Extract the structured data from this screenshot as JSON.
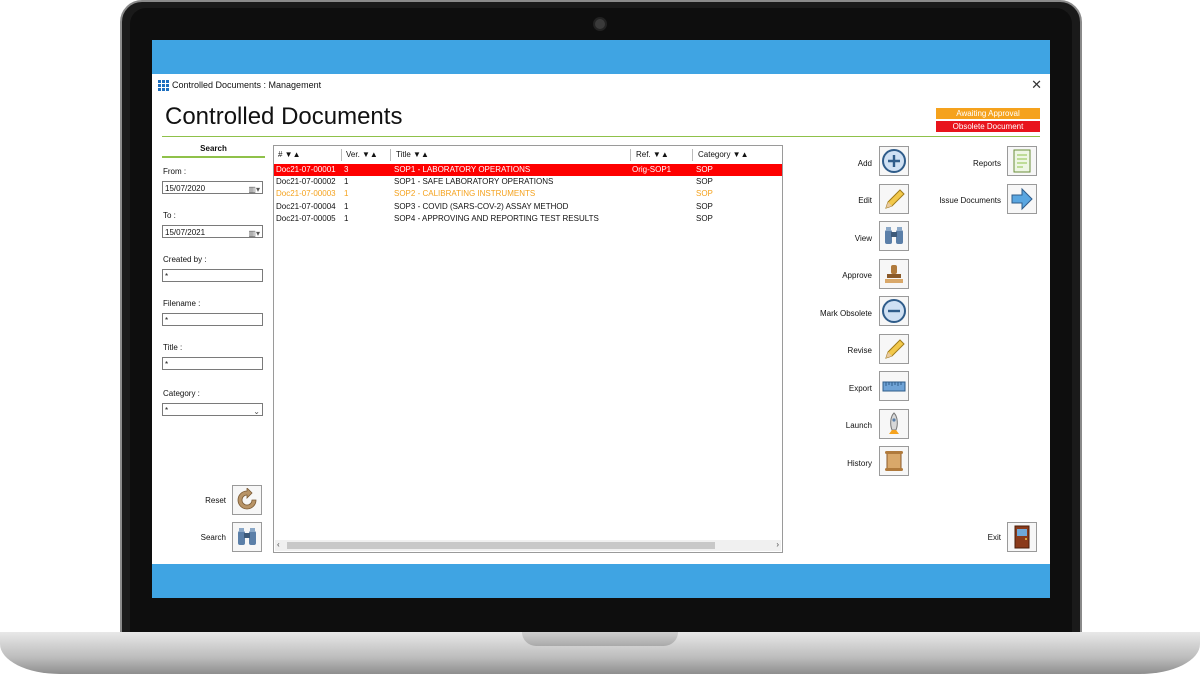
{
  "window": {
    "title": "Controlled Documents :  Management",
    "close_label": "✕"
  },
  "heading": "Controlled Documents",
  "legend": {
    "awaiting": "Awaiting Approval",
    "obsolete": "Obsolete Document"
  },
  "search_panel": {
    "title": "Search",
    "from_label": "From :",
    "from_value": "15/07/2020",
    "to_label": "To :",
    "to_value": "15/07/2021",
    "created_by_label": "Created by :",
    "created_by_value": "*",
    "filename_label": "Filename :",
    "filename_value": "*",
    "title_label": "Title :",
    "title_value": "*",
    "category_label": "Category :",
    "category_value": "*",
    "reset_label": "Reset",
    "search_label": "Search"
  },
  "table": {
    "headers": [
      "# ▼▲",
      "Ver. ▼▲",
      "Title ▼▲",
      "Ref. ▼▲",
      "Category ▼▲"
    ],
    "rows": [
      {
        "id": "Doc21-07-00001",
        "ver": "3",
        "title": "SOP1 - LABORATORY OPERATIONS",
        "ref": "Orig-SOP1",
        "category": "SOP",
        "state": "obsolete"
      },
      {
        "id": "Doc21-07-00002",
        "ver": "1",
        "title": "SOP1 - SAFE LABORATORY OPERATIONS",
        "ref": "",
        "category": "SOP",
        "state": "normal"
      },
      {
        "id": "Doc21-07-00003",
        "ver": "1",
        "title": "SOP2 - CALIBRATING INSTRUMENTS",
        "ref": "",
        "category": "SOP",
        "state": "awaiting"
      },
      {
        "id": "Doc21-07-00004",
        "ver": "1",
        "title": "SOP3 - COVID (SARS-COV-2) ASSAY METHOD",
        "ref": "",
        "category": "SOP",
        "state": "normal"
      },
      {
        "id": "Doc21-07-00005",
        "ver": "1",
        "title": "SOP4 - APPROVING AND REPORTING TEST RESULTS",
        "ref": "",
        "category": "SOP",
        "state": "normal"
      }
    ]
  },
  "actions": {
    "add": "Add",
    "edit": "Edit",
    "view": "View",
    "approve": "Approve",
    "mark_obsolete": "Mark Obsolete",
    "revise": "Revise",
    "export": "Export",
    "launch": "Launch",
    "history": "History",
    "reports": "Reports",
    "issue_documents": "Issue Documents",
    "exit": "Exit"
  },
  "colors": {
    "accent_blue": "#3fa4e3",
    "selected_row": "#fe0000",
    "awaiting": "#f5a21d",
    "obsolete": "#e8141c",
    "divider": "#8fc14a"
  }
}
